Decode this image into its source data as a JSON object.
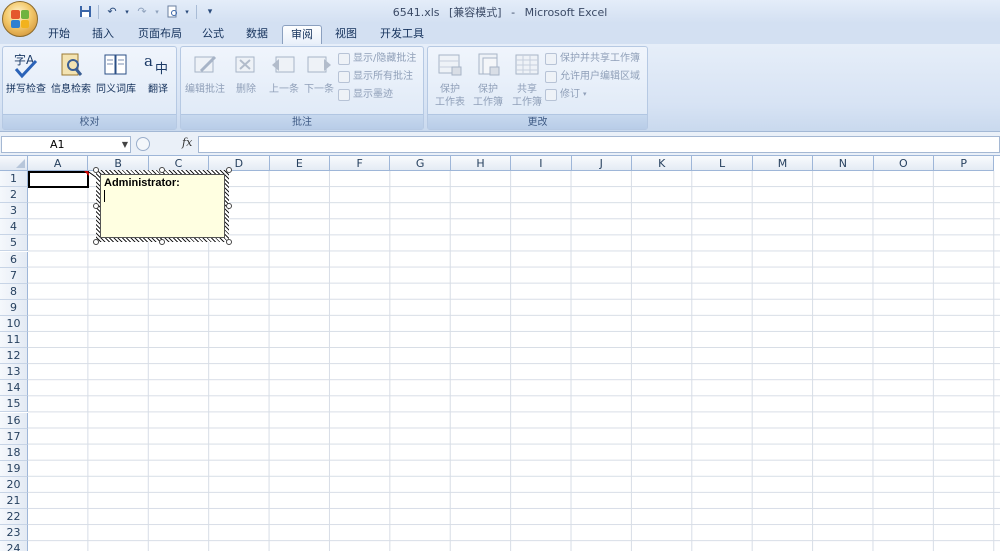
{
  "window": {
    "file_name": "6541.xls",
    "mode": "[兼容模式]",
    "sep": "-",
    "app_name": "Microsoft Excel"
  },
  "quick_access": [
    "save-icon",
    "undo-icon",
    "redo-icon",
    "print-preview-icon",
    "customize-icon"
  ],
  "tabs": [
    {
      "label": "开始"
    },
    {
      "label": "插入"
    },
    {
      "label": "页面布局"
    },
    {
      "label": "公式"
    },
    {
      "label": "数据"
    },
    {
      "label": "审阅"
    },
    {
      "label": "视图"
    },
    {
      "label": "开发工具"
    }
  ],
  "active_tab": "审阅",
  "ribbon": {
    "proofing": {
      "label": "校对",
      "buttons": [
        "拼写检查",
        "信息检索",
        "同义词库",
        "翻译"
      ]
    },
    "comments": {
      "label": "批注",
      "buttons": [
        "编辑批注",
        "删除",
        "上一条",
        "下一条"
      ],
      "small": [
        "显示/隐藏批注",
        "显示所有批注",
        "显示墨迹"
      ]
    },
    "changes": {
      "label": "更改",
      "big": [
        {
          "line1": "保护",
          "line2": "工作表"
        },
        {
          "line1": "保护",
          "line2": "工作簿"
        },
        {
          "line1": "共享",
          "line2": "工作簿"
        }
      ],
      "small": [
        "保护并共享工作簿",
        "允许用户编辑区域",
        "修订"
      ]
    }
  },
  "formula_bar": {
    "name_box": "A1",
    "fx": "fx",
    "formula": ""
  },
  "columns": [
    "A",
    "B",
    "C",
    "D",
    "E",
    "F",
    "G",
    "H",
    "I",
    "J",
    "K",
    "L",
    "M",
    "N",
    "O",
    "P"
  ],
  "rows": [
    "1",
    "2",
    "3",
    "4",
    "5",
    "6",
    "7",
    "8",
    "9",
    "10",
    "11",
    "12",
    "13",
    "14",
    "15",
    "16",
    "17",
    "18",
    "19",
    "20",
    "21",
    "22",
    "23",
    "24"
  ],
  "comment": {
    "author": "Administrator:"
  },
  "colors": {
    "ribbon_bg": "#dbe6f5",
    "comment_bg": "#ffffe1",
    "comment_marker": "#d00000"
  }
}
